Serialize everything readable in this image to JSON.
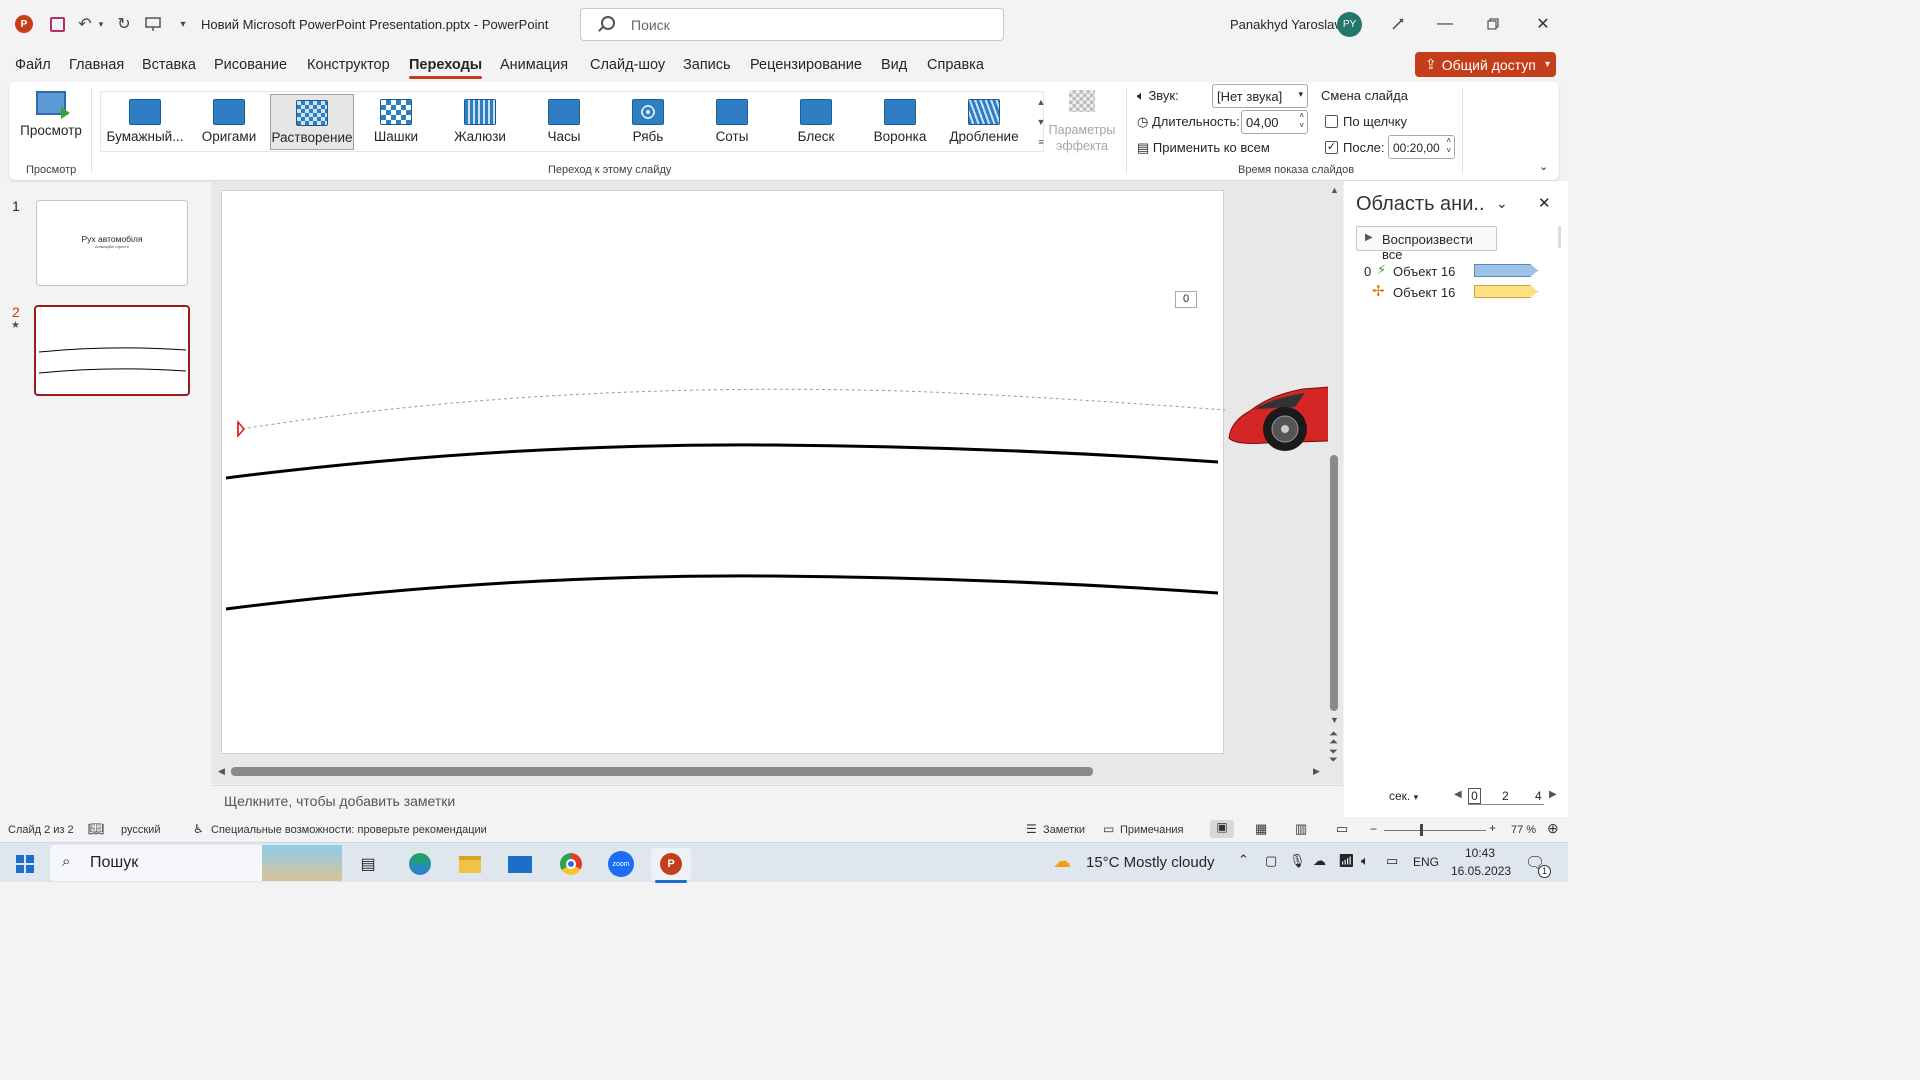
{
  "title_bar": {
    "doc_title": "Новий Microsoft PowerPoint Presentation.pptx  -  PowerPoint",
    "search_placeholder": "Поиск",
    "user_name": "Panakhyd Yaroslav",
    "avatar_initials": "PY"
  },
  "menu": [
    "Файл",
    "Главная",
    "Вставка",
    "Рисование",
    "Конструктор",
    "Переходы",
    "Анимация",
    "Слайд-шоу",
    "Запись",
    "Рецензирование",
    "Вид",
    "Справка"
  ],
  "share_label": "Общий доступ",
  "ribbon": {
    "preview_label": "Просмотр",
    "preview_group": "Просмотр",
    "transitions": [
      "Бумажный...",
      "Оригами",
      "Растворение",
      "Шашки",
      "Жалюзи",
      "Часы",
      "Рябь",
      "Соты",
      "Блеск",
      "Воронка",
      "Дробление"
    ],
    "transitions_group": "Переход к этому слайду",
    "effect_params": "Параметры эффекта",
    "sound_label": "Звук:",
    "sound_value": "[Нет звука]",
    "duration_label": "Длительность:",
    "duration_value": "04,00",
    "apply_all": "Применить ко всем",
    "advance_title": "Смена слайда",
    "on_click": "По щелчку",
    "after_label": "После:",
    "after_value": "00:20,00",
    "timing_group": "Время показа слайдов"
  },
  "slides": {
    "thumb1_num": "1",
    "thumb1_title": "Рух автомобіля",
    "thumb1_sub": "Анімаційні ефекти",
    "thumb2_num": "2",
    "thumb2_star": "★"
  },
  "slide_canvas": {
    "anim_tag": "0"
  },
  "notes_placeholder": "Щелкните, чтобы добавить заметки",
  "anim_pane": {
    "title": "Область ани..",
    "play_all": "Воспроизвести все",
    "items": [
      {
        "index": "0",
        "label": "Объект 16",
        "bar_color": "#9dc3e6"
      },
      {
        "index": "",
        "label": "Объект 16",
        "bar_color": "#ffe081"
      }
    ],
    "sec_label": "сек.",
    "timeline": [
      "0",
      "2",
      "4"
    ]
  },
  "status_bar": {
    "slide_info": "Слайд 2 из 2",
    "language": "русский",
    "accessibility": "Специальные возможности: проверьте рекомендации",
    "notes": "Заметки",
    "comments": "Примечания",
    "zoom": "77 %"
  },
  "taskbar": {
    "search": "Пошук",
    "weather": "15°C  Mostly cloudy",
    "lang": "ENG",
    "time": "10:43",
    "date": "16.05.2023",
    "notif_count": "1"
  },
  "colors": {
    "accent": "#c43e1c",
    "selected_slide_border": "#9b1c1c"
  }
}
